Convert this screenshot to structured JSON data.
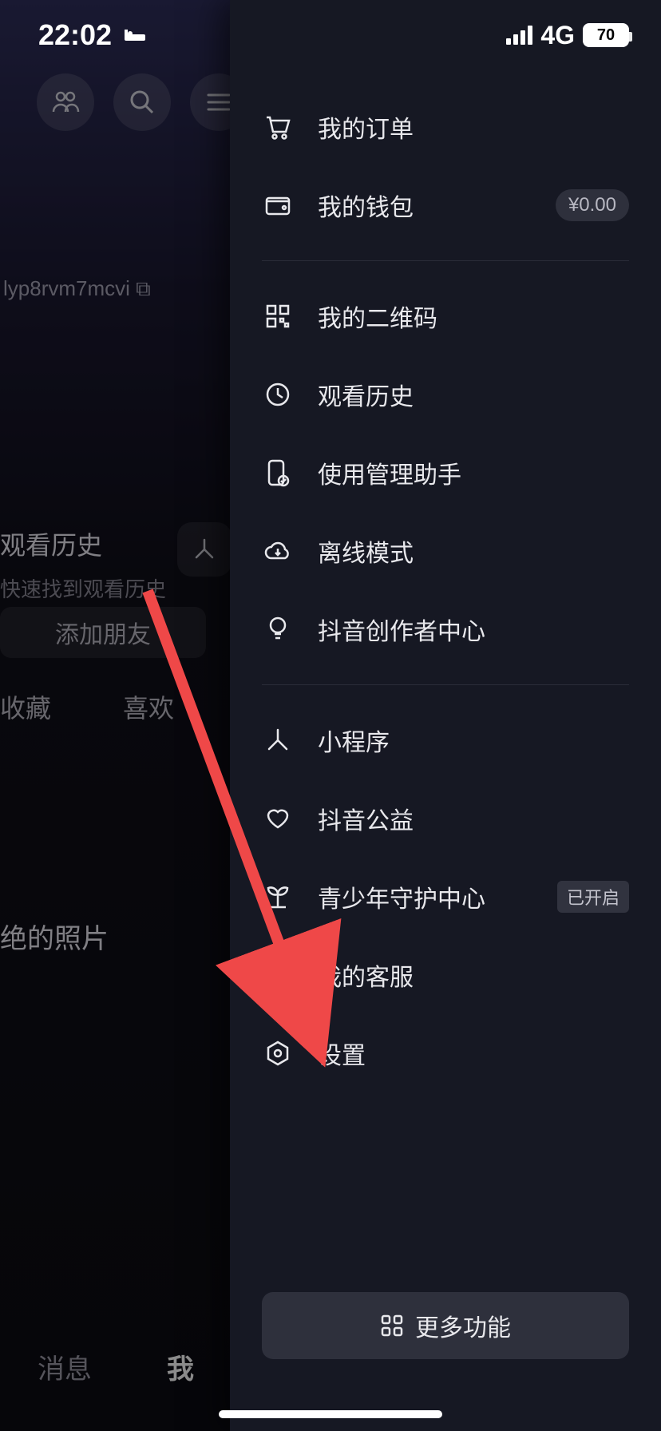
{
  "status": {
    "time": "22:02",
    "network": "4G",
    "battery": "70"
  },
  "background": {
    "user_id": "lyp8rvm7mcvi",
    "history_title": "观看历史",
    "history_sub": "快速找到观看历史",
    "add_friend": "添加朋友",
    "tab_favorite": "收藏",
    "tab_like": "喜欢",
    "photo_text": "绝的照片",
    "bottom_messages": "消息",
    "bottom_profile": "我"
  },
  "drawer": {
    "items": [
      {
        "label": "我的订单"
      },
      {
        "label": "我的钱包",
        "badge": "¥0.00"
      },
      {
        "label": "我的二维码"
      },
      {
        "label": "观看历史"
      },
      {
        "label": "使用管理助手"
      },
      {
        "label": "离线模式"
      },
      {
        "label": "抖音创作者中心"
      },
      {
        "label": "小程序"
      },
      {
        "label": "抖音公益"
      },
      {
        "label": "青少年守护中心",
        "tag": "已开启"
      },
      {
        "label": "我的客服"
      },
      {
        "label": "设置"
      }
    ],
    "more_label": "更多功能"
  }
}
